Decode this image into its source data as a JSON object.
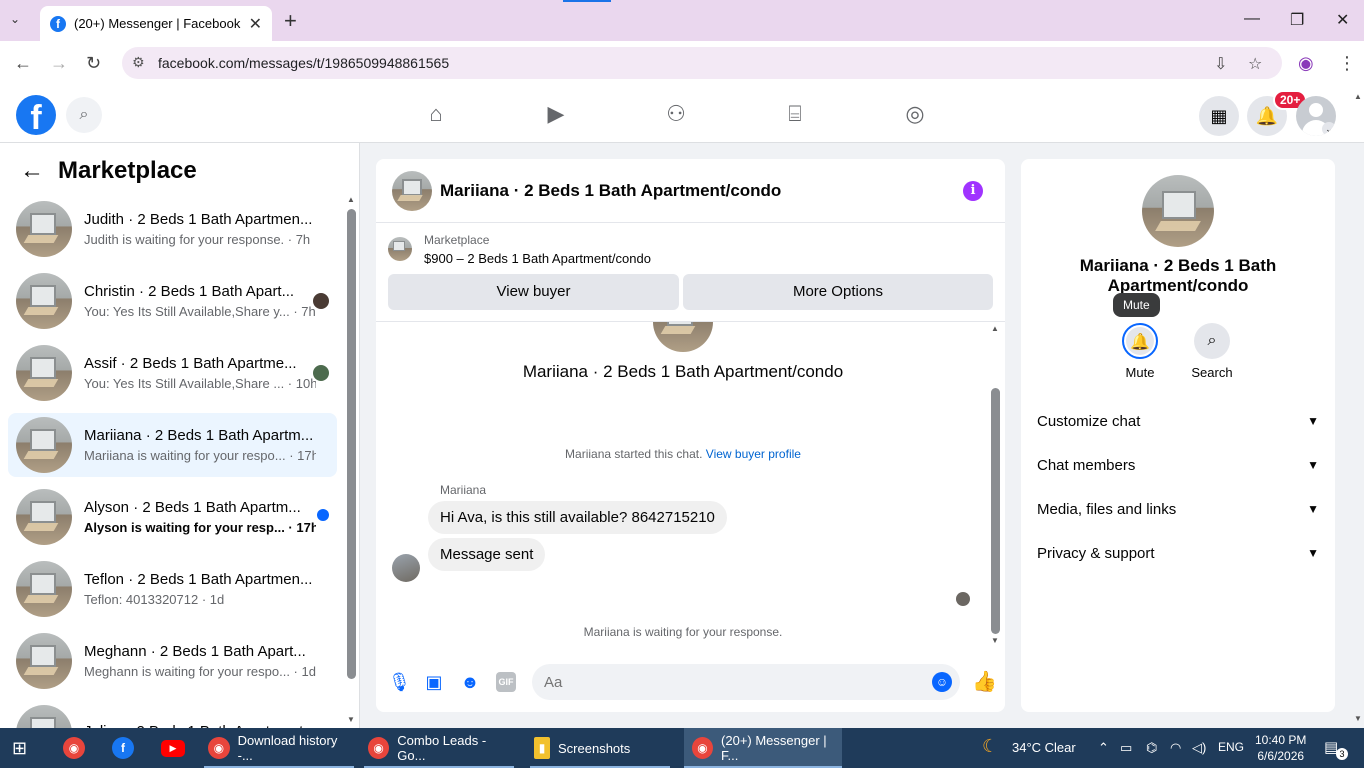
{
  "browser": {
    "tab_title": "(20+) Messenger | Facebook",
    "url": "facebook.com/messages/t/1986509948861565"
  },
  "fb": {
    "badge": "20+"
  },
  "sidebar": {
    "title": "Marketplace",
    "conversations": [
      {
        "name": "Judith · 2 Beds 1 Bath Apartmen...",
        "preview": "Judith is waiting for your response. · 7h",
        "right": "none",
        "unread": false,
        "selected": false
      },
      {
        "name": "Christin · 2 Beds 1 Bath Apart...",
        "preview": "You: Yes Its Still Available,Share y... · 7h",
        "right": "avatar",
        "unread": false,
        "selected": false
      },
      {
        "name": "Assif · 2 Beds 1 Bath Apartme...",
        "preview": "You: Yes Its Still Available,Share ... · 10h",
        "right": "avatar-green",
        "unread": false,
        "selected": false
      },
      {
        "name": "Mariiana · 2 Beds 1 Bath Apartm...",
        "preview": "Mariiana is waiting for your respo... · 17h",
        "right": "none",
        "unread": false,
        "selected": true
      },
      {
        "name": "Alyson · 2 Beds 1 Bath Apartm...",
        "preview": "Alyson is waiting for your resp... · 17h",
        "right": "dot",
        "unread": true,
        "selected": false
      },
      {
        "name": "Teflon · 2 Beds 1 Bath Apartmen...",
        "preview": "Teflon: 4013320712 · 1d",
        "right": "none",
        "unread": false,
        "selected": false
      },
      {
        "name": "Meghann · 2 Beds 1 Bath Apart...",
        "preview": "Meghann is waiting for your respo... · 1d",
        "right": "none",
        "unread": false,
        "selected": false
      },
      {
        "name": "Julian · 2 Beds 1 Bath Apartment...",
        "preview": "",
        "right": "none",
        "unread": false,
        "selected": false
      }
    ]
  },
  "chat": {
    "title": "Mariiana · 2 Beds 1 Bath Apartment/condo",
    "listing_source": "Marketplace",
    "listing_price": "$900 – 2 Beds 1 Bath Apartment/condo",
    "view_buyer": "View buyer",
    "more_options": "More Options",
    "intro_name": "Mariiana · 2 Beds 1 Bath Apartment/condo",
    "started_text": "Mariiana started this chat.",
    "view_profile": "View buyer profile",
    "sender": "Mariiana",
    "messages": [
      "Hi Ava, is this still available? 8642715210",
      "Message sent"
    ],
    "waiting": "Mariiana is waiting for your response.",
    "placeholder": "Aa"
  },
  "info": {
    "name": "Mariiana · 2 Beds 1 Bath Apartment/condo",
    "tooltip": "Mute",
    "mute_label": "Mute",
    "search_label": "Search",
    "sections": [
      "Customize chat",
      "Chat members",
      "Media, files and links",
      "Privacy & support"
    ]
  },
  "taskbar": {
    "items": [
      "Download history -...",
      "Combo Leads - Go...",
      "Screenshots",
      "(20+) Messenger | F..."
    ],
    "weather": "34°C  Clear",
    "lang": "ENG",
    "time": "10:40 PM",
    "date": "6/6/2026",
    "notif_count": "3"
  },
  "colors": {
    "fb_blue": "#1877f2",
    "messenger_blue": "#0866ff",
    "badge_red": "#e41e3f",
    "selected_bg": "#ebf5ff",
    "info_purple": "#a033ff"
  }
}
